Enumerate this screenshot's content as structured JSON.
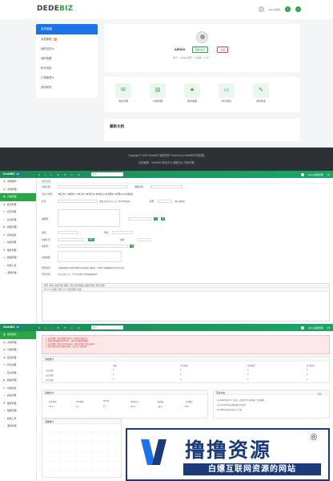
{
  "site": {
    "logo_main": "DEDE",
    "logo_accent": "BIZ",
    "header_user": "admin会员",
    "header_btn": "+",
    "side_menu": [
      {
        "label": "会员面板"
      },
      {
        "label": "消息管理",
        "badge": "1"
      },
      {
        "label": "我的文档 ▾"
      },
      {
        "label": "我的收藏"
      },
      {
        "label": "积分钱包"
      },
      {
        "label": "订单管理 ▾"
      },
      {
        "label": "资料修改"
      }
    ],
    "profile": {
      "name": "admin",
      "tag1": "限制会员",
      "tag2": "注销",
      "stats": "积分：10000  金币：0  余额：0.00"
    },
    "quick": [
      {
        "label": "消息管理",
        "icon": "chat-icon",
        "glyph": "✉"
      },
      {
        "label": "文档管理",
        "icon": "doc-icon",
        "glyph": "▤"
      },
      {
        "label": "我的收藏",
        "icon": "star-icon",
        "glyph": "★"
      },
      {
        "label": "积分钱包",
        "icon": "wallet-icon",
        "glyph": "▭"
      },
      {
        "label": "资料修改",
        "icon": "edit-icon",
        "glyph": "✎"
      }
    ],
    "news_title": "最新文档",
    "footer_line1": "Copyright © 2023 DedeBIZ 版权所有 Powered by DedeBIZ开发团队",
    "footer_line2": "友情链接：DedeBIZ 商业中心  模板中心  代码托管"
  },
  "admin": {
    "brand": "DedeBIZ",
    "version": "V6",
    "search_placeholder": "搜索",
    "user": "admin系统管理",
    "top_icons": [
      "≡",
      "⌂",
      "◐",
      "✉",
      "⟳",
      "◇",
      "◎"
    ],
    "nav": [
      {
        "label": "常用操作",
        "icon": "▤"
      },
      {
        "label": "文档管理",
        "icon": "▤"
      },
      {
        "label": "分类管理",
        "icon": "▤"
      },
      {
        "label": "会员管理",
        "icon": "♟"
      },
      {
        "label": "评论管理",
        "icon": "✉"
      },
      {
        "label": "互动管理",
        "icon": "♲"
      },
      {
        "label": "模板管理",
        "icon": "◧"
      },
      {
        "label": "系统设置",
        "icon": "⚙"
      },
      {
        "label": "采集管理",
        "icon": "⇩"
      },
      {
        "label": "插件管理",
        "icon": "⚑"
      },
      {
        "label": "数据管理",
        "icon": "◫"
      },
      {
        "label": "系统工具",
        "icon": "✧"
      },
      {
        "label": "其他功能",
        "icon": "⋯"
      }
    ],
    "tab_label": "发布文档",
    "form": {
      "title": "文档标题：",
      "short_title": "简略标题：",
      "attr": "自定义属性：",
      "attr_opts": [
        "头条[h]",
        "推荐[c]",
        "幻灯[f]",
        "特荐[a]",
        "滚动[s]",
        "加粗[b]",
        "图片[p]",
        "跳转[j]"
      ],
      "tags": "标签：",
      "tags_hint": "(用英文逗号分开，如：DedeBIZ,建站)",
      "weight": "权重：",
      "weight_hint": "(越小越靠前)",
      "thumb": "缩略图：",
      "thumb_btn": "上传",
      "thumb_btn2": "站内",
      "source": "来源：",
      "author": "作者：",
      "category": "文档栏目：",
      "sub_category": "副栏目：",
      "keywords": "关键词：",
      "keywords_btn": "自动获取",
      "desc": "文档摘要：",
      "options": "附加选项：",
      "options_text": "下载远程图片和资源 删除非站内链接 提取第一个图片为缩略图 图片是否加水印",
      "paging": "分页方式：",
      "paging_text": "手动 自动  大小：5  K (分页符为 #p#副标题#e#)",
      "editor_toolbar": "源码  |  保存  新建  预览  模板  |  剪切  复制  粘贴  |  撤销  重做  |  查找  替换",
      "editor_toolbar2": "B  I  U  S  |  段落  字体  大小  |  链接  图片  表格"
    },
    "alert_lines": [
      "1. 安全提醒：默认管理员admin，建议修改用户名",
      "2. 您使用的数据库是MySQL，建议定期备份数据库",
      "3. 安全提醒：默认后台目录dede，建议修改后台目录名称",
      "4. 您的系统尚未注册商业授权，请点击 立即注册"
    ],
    "stats_title": "文档统计",
    "stats_head": [
      "",
      "总数",
      "今日新增",
      "本周新增",
      "本月新增"
    ],
    "stats_rows": [
      [
        "文档总数",
        "0",
        "0",
        "0",
        "0"
      ],
      [
        "会员总数",
        "1",
        "0",
        "0",
        "0"
      ],
      [
        "评论总数",
        "0",
        "0",
        "0",
        "0"
      ]
    ],
    "sys_title": "系统信息",
    "sys_cols": [
      "软件版本",
      "PHP版本",
      "MySQL",
      "系统时间",
      "服务器",
      "上传限制"
    ],
    "sys_vals": [
      "V6.2.7",
      "8.0",
      "5.7",
      "09:21",
      "nginx",
      "50M"
    ],
    "news_title": "官方动态",
    "news_more": "更多",
    "news_lines": [
      "DedeBIZ系统V6.2.7发布，修复若干已知问题，欢迎更新",
      "关于DedeBIZ商业授权服务的说明",
      "DedeBIZ开发者社区正式上线"
    ],
    "chart_title": "流量统计"
  },
  "watermark": {
    "title": "撸撸资源",
    "reg": "®",
    "subtitle": "白嫖互联网资源的网站"
  }
}
